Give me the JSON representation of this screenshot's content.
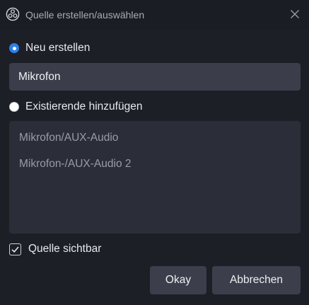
{
  "window": {
    "title": "Quelle erstellen/auswählen",
    "app_icon": "obs-logo-icon",
    "close_icon": "close-icon"
  },
  "options": {
    "new_label": "Neu erstellen",
    "new_selected": true,
    "existing_label": "Existierende hinzufügen",
    "existing_selected": false
  },
  "name_input": {
    "value": "Mikrofon"
  },
  "existing_sources": [
    "Mikrofon/AUX-Audio",
    "Mikrofon-/AUX-Audio 2"
  ],
  "visible_checkbox": {
    "label": "Quelle sichtbar",
    "checked": true
  },
  "buttons": {
    "okay": "Okay",
    "cancel": "Abbrechen"
  },
  "colors": {
    "background": "#1d1f26",
    "accent": "#2f80e6",
    "input_bg": "#3b3e4a",
    "list_bg": "#2b2e38",
    "button_bg": "#3c3f4b"
  }
}
